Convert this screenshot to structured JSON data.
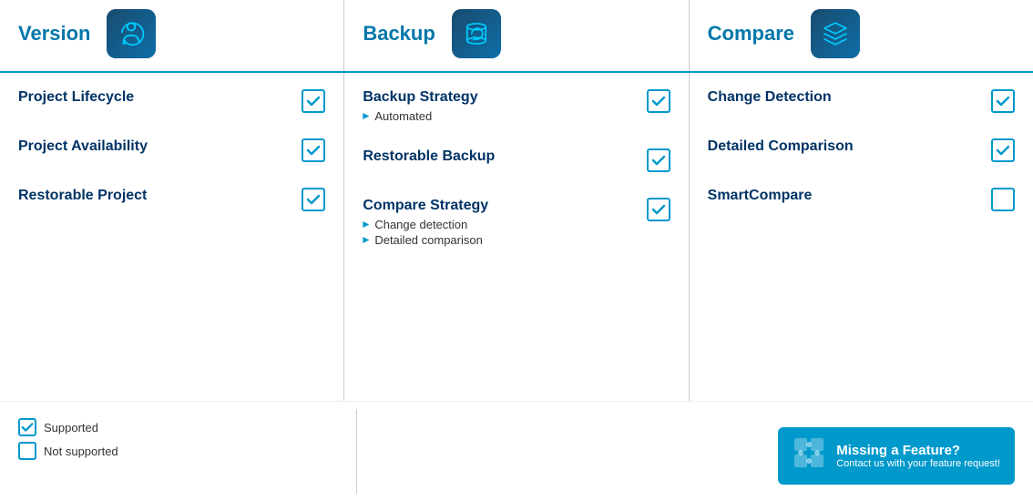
{
  "header": {
    "version_title": "Version",
    "backup_title": "Backup",
    "compare_title": "Compare"
  },
  "version_features": [
    {
      "name": "Project Lifecycle",
      "checked": true,
      "sub": []
    },
    {
      "name": "Project Availability",
      "checked": true,
      "sub": []
    },
    {
      "name": "Restorable Project",
      "checked": true,
      "sub": []
    }
  ],
  "backup_features": [
    {
      "name": "Backup Strategy",
      "checked": true,
      "sub": [
        "Automated"
      ]
    },
    {
      "name": "Restorable Backup",
      "checked": true,
      "sub": []
    },
    {
      "name": "Compare Strategy",
      "checked": true,
      "sub": [
        "Change detection",
        "Detailed comparison"
      ]
    }
  ],
  "compare_features": [
    {
      "name": "Change Detection",
      "checked": true,
      "sub": []
    },
    {
      "name": "Detailed Comparison",
      "checked": true,
      "sub": []
    },
    {
      "name": "SmartCompare",
      "checked": false,
      "sub": []
    }
  ],
  "legend": {
    "supported_label": "Supported",
    "not_supported_label": "Not supported"
  },
  "missing_feature": {
    "title": "Missing a Feature?",
    "subtitle": "Contact us with your feature request!"
  }
}
